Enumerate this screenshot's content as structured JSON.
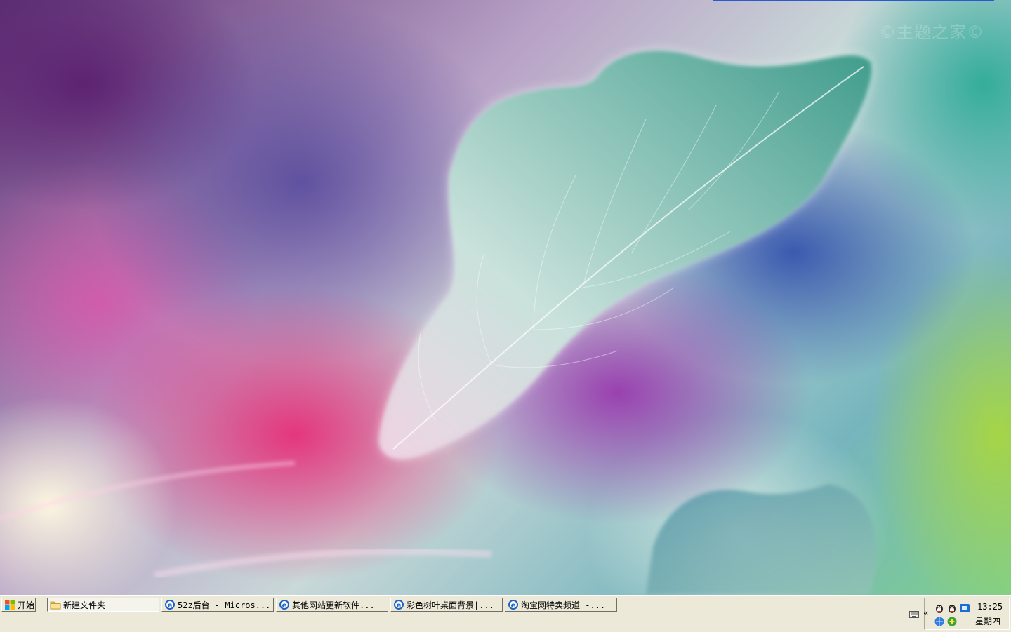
{
  "desktop": {
    "watermark": "©主题之家©"
  },
  "taskbar": {
    "start_label": "开始",
    "buttons": [
      {
        "label": "新建文件夹",
        "icon": "folder-icon",
        "active": true
      },
      {
        "label": "52z后台 - Micros...",
        "icon": "ie-icon"
      },
      {
        "label": "其他网站更新软件...",
        "icon": "ie-icon"
      },
      {
        "label": "彩色树叶桌面背景|...",
        "icon": "ie-icon"
      },
      {
        "label": "淘宝网特卖频道 -...",
        "icon": "ie-icon"
      }
    ],
    "tray": {
      "expand_label": "«",
      "icons": [
        "qq-penguin-icon",
        "qq-penguin-icon",
        "network-icon",
        "ie-blue-globe-icon",
        "green-plus-icon"
      ],
      "time": "13:25",
      "day": "星期四"
    }
  },
  "colors": {
    "taskbar_bg": "#ece9d8",
    "title_blue": "#2a5ad3"
  }
}
